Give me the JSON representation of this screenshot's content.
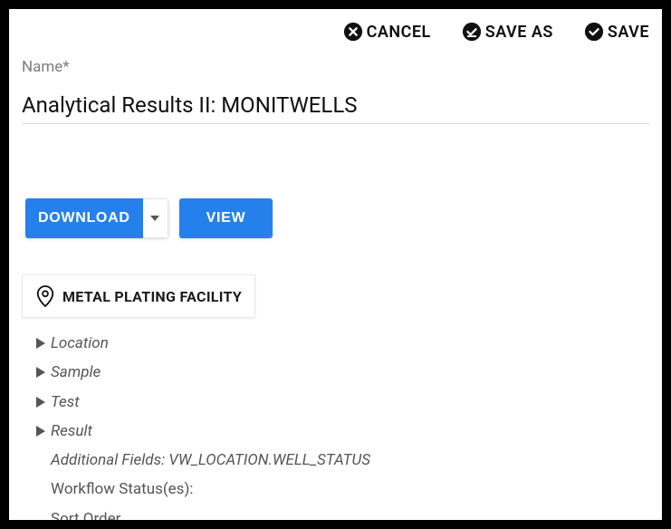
{
  "actions": {
    "cancel": "CANCEL",
    "save_as": "SAVE AS",
    "save": "SAVE"
  },
  "name_field": {
    "label": "Name*",
    "value": "Analytical Results II: MONITWELLS"
  },
  "buttons": {
    "download": "DOWNLOAD",
    "view": "VIEW"
  },
  "facility_chip": "METAL PLATING FACILITY",
  "tree": {
    "location": "Location",
    "sample": "Sample",
    "test": "Test",
    "result": "Result",
    "additional_fields": "Additional Fields: VW_LOCATION.WELL_STATUS",
    "workflow_status": "Workflow Status(es):",
    "sort_order": "Sort Order"
  }
}
